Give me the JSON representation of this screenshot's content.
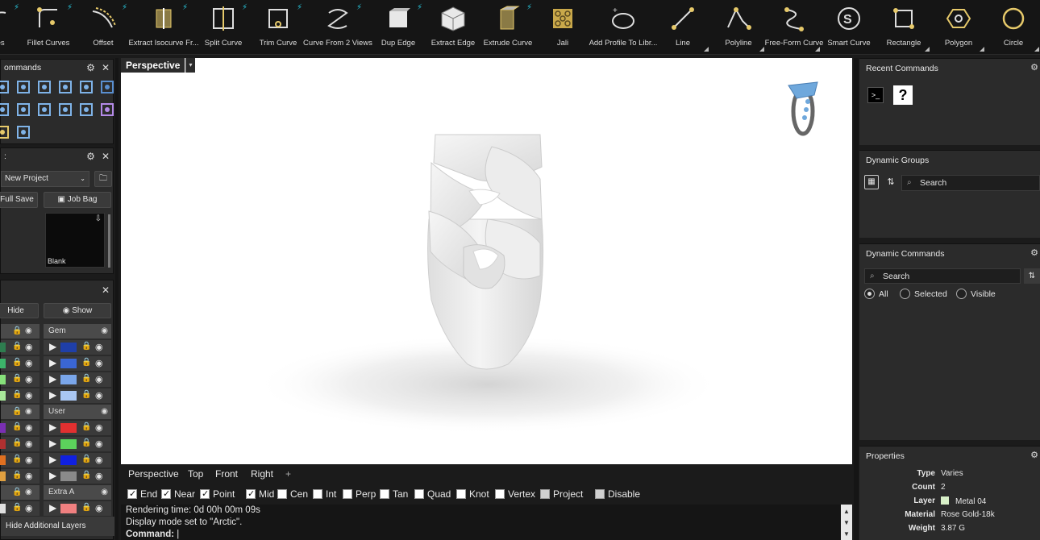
{
  "toolbar": {
    "items": [
      {
        "label": "urves",
        "icon": "curves-icon",
        "bolt": true,
        "tri": false
      },
      {
        "label": "Fillet Curves",
        "icon": "fillet-curves-icon",
        "bolt": true,
        "tri": false
      },
      {
        "label": "Offset",
        "icon": "offset-icon",
        "bolt": true,
        "tri": false
      },
      {
        "label": "Extract Isocurve Fr...",
        "icon": "extract-isocurve-icon",
        "bolt": true,
        "tri": false
      },
      {
        "label": "Split Curve",
        "icon": "split-curve-icon",
        "bolt": true,
        "tri": false
      },
      {
        "label": "Trim Curve",
        "icon": "trim-curve-icon",
        "bolt": true,
        "tri": false
      },
      {
        "label": "Curve From 2 Views",
        "icon": "curve-from-2-views-icon",
        "bolt": true,
        "tri": false
      },
      {
        "label": "Dup Edge",
        "icon": "dup-edge-icon",
        "bolt": true,
        "tri": false
      },
      {
        "label": "Extract Edge",
        "icon": "extract-edge-icon",
        "bolt": false,
        "tri": false
      },
      {
        "label": "Extrude Curve",
        "icon": "extrude-curve-icon",
        "bolt": true,
        "tri": false
      },
      {
        "label": "Jali",
        "icon": "jali-icon",
        "bolt": false,
        "tri": false
      },
      {
        "label": "Add Profile To Libr...",
        "icon": "add-profile-icon",
        "bolt": false,
        "tri": false
      },
      {
        "label": "Line",
        "icon": "line-icon",
        "bolt": false,
        "tri": true
      },
      {
        "label": "Polyline",
        "icon": "polyline-icon",
        "bolt": false,
        "tri": true
      },
      {
        "label": "Free-Form Curve",
        "icon": "free-form-curve-icon",
        "bolt": false,
        "tri": true
      },
      {
        "label": "Smart Curve",
        "icon": "smart-curve-icon",
        "bolt": false,
        "tri": false
      },
      {
        "label": "Rectangle",
        "icon": "rectangle-icon",
        "bolt": false,
        "tri": true
      },
      {
        "label": "Polygon",
        "icon": "polygon-icon",
        "bolt": false,
        "tri": true
      },
      {
        "label": "Circle",
        "icon": "circle-icon",
        "bolt": false,
        "tri": true
      }
    ]
  },
  "left": {
    "quick_access": {
      "title": "ommands"
    },
    "project": {
      "name": "New Project",
      "full_save": "Full Save",
      "job_bag": "Job Bag",
      "thumb_label": "Blank"
    },
    "layers": {
      "hide": "Hide",
      "show": "Show",
      "groups": [
        {
          "name": "Gem",
          "swatches": [
            "#1f3fa8",
            "#3a66d4",
            "#7aa6ea",
            "#a9c6f2"
          ]
        },
        {
          "name": "User",
          "swatches": [
            "#e23030",
            "#5cd15c",
            "#1020e0",
            "#8a8a8a"
          ]
        },
        {
          "name": "Extra A",
          "swatches": [
            "#f08080"
          ]
        }
      ],
      "left_column_colors": [
        "#2e7d4f",
        "#3cb46a",
        "#86e07a",
        "#a9e89a",
        "#7a2fb3",
        "#b03030",
        "#e07020",
        "#e0a040",
        "#e0e0e0"
      ],
      "hide_additional": "Hide Additional Layers"
    }
  },
  "viewport": {
    "tab": "Perspective",
    "view_tabs": [
      "Perspective",
      "Top",
      "Front",
      "Right"
    ],
    "add_view": "+"
  },
  "osnaps": [
    {
      "label": "End",
      "checked": true
    },
    {
      "label": "Near",
      "checked": true
    },
    {
      "label": "Point",
      "checked": true
    },
    {
      "label": "Mid",
      "checked": true
    },
    {
      "label": "Cen",
      "checked": false
    },
    {
      "label": "Int",
      "checked": false
    },
    {
      "label": "Perp",
      "checked": false
    },
    {
      "label": "Tan",
      "checked": false
    },
    {
      "label": "Quad",
      "checked": false
    },
    {
      "label": "Knot",
      "checked": false
    },
    {
      "label": "Vertex",
      "checked": false
    },
    {
      "label": "Project",
      "checked": false
    },
    {
      "label": "Disable",
      "checked": false
    }
  ],
  "command": {
    "line1": "Rendering time: 0d 00h 00m 09s",
    "line2": "Display mode set to \"Arctic\".",
    "prompt": "Command:"
  },
  "right": {
    "recent_commands": {
      "title": "Recent Commands"
    },
    "dynamic_groups": {
      "title": "Dynamic Groups",
      "search_placeholder": "Search"
    },
    "dynamic_commands": {
      "title": "Dynamic Commands",
      "search_placeholder": "Search",
      "filters": [
        {
          "label": "All",
          "selected": true
        },
        {
          "label": "Selected",
          "selected": false
        },
        {
          "label": "Visible",
          "selected": false
        }
      ]
    },
    "properties": {
      "title": "Properties",
      "rows": [
        {
          "key": "Type",
          "value": "Varies"
        },
        {
          "key": "Count",
          "value": "2"
        },
        {
          "key": "Layer",
          "value": "Metal 04",
          "swatch": "#d8f0c8"
        },
        {
          "key": "Material",
          "value": "Rose Gold-18k"
        },
        {
          "key": "Weight",
          "value": "3.87 G"
        }
      ]
    }
  }
}
